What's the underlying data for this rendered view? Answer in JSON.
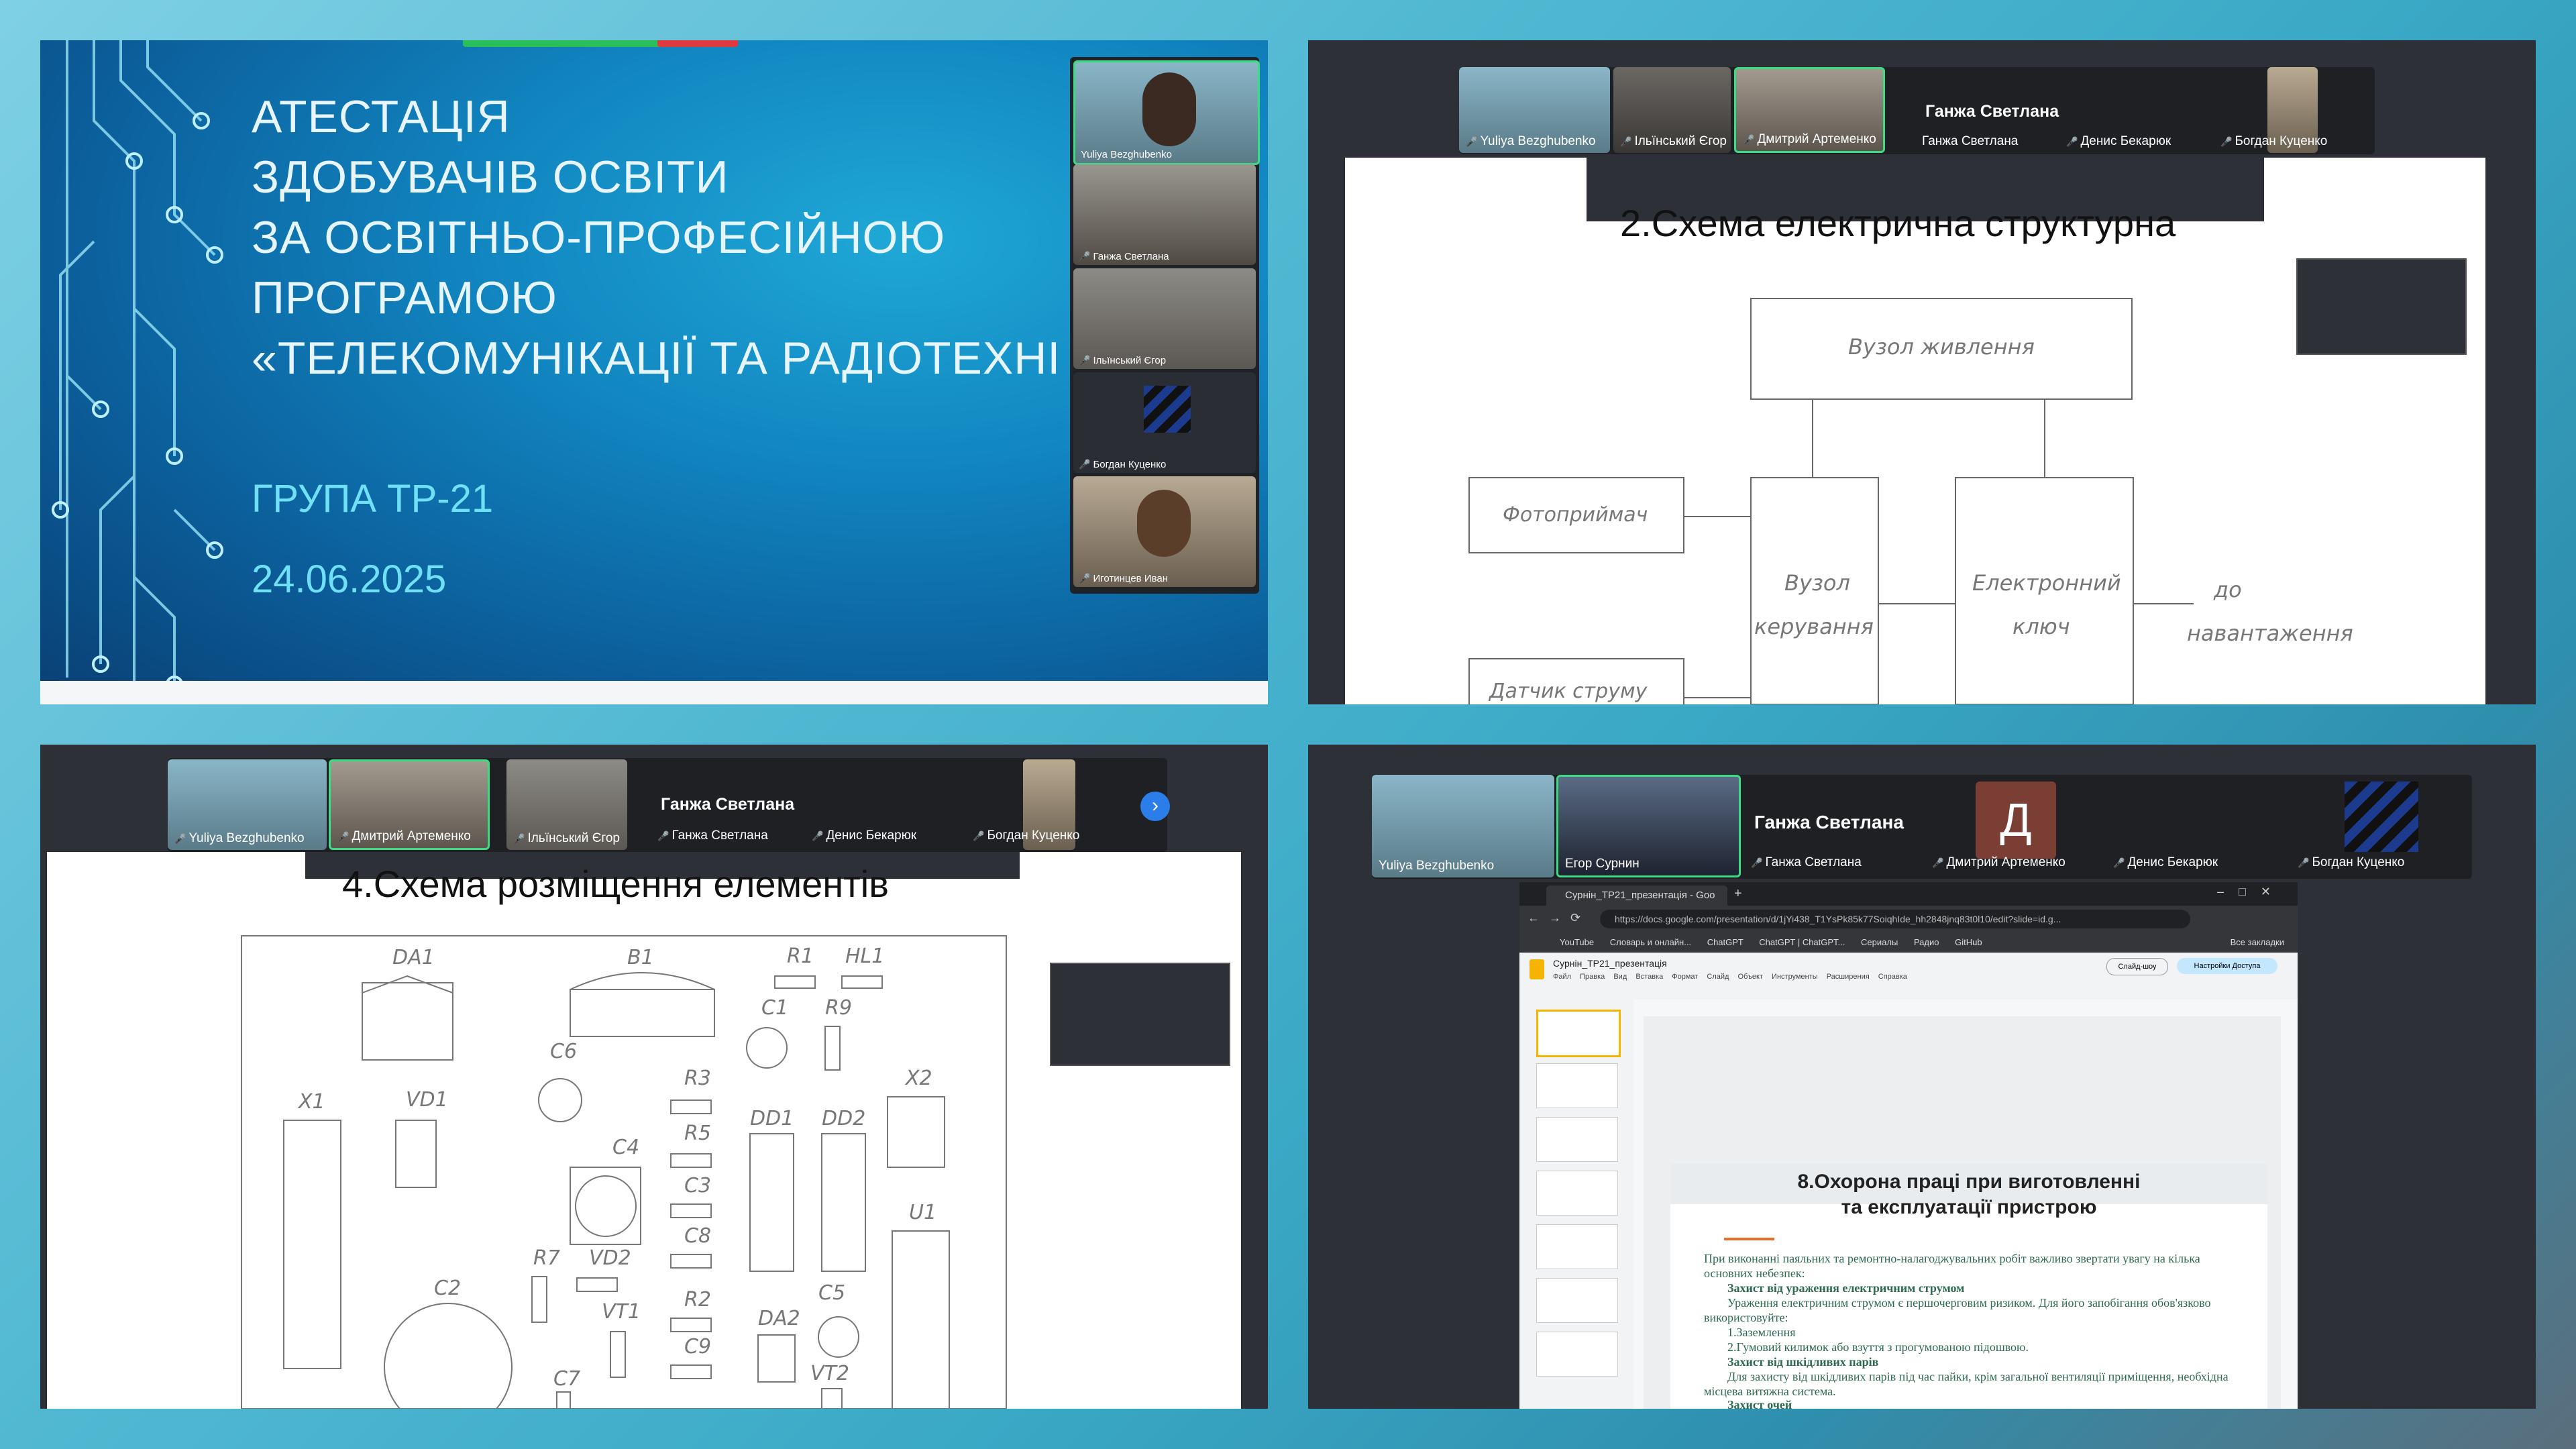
{
  "panel1": {
    "title_lines": [
      "АТЕСТАЦІЯ",
      "ЗДОБУВАЧІВ ОСВІТИ",
      "ЗА ОСВІТНЬО-ПРОФЕСІЙНОЮ",
      "ПРОГРАМОЮ",
      "«ТЕЛЕКОМУНІКАЦІЇ ТА РАДІОТЕХНІ"
    ],
    "group": "ГРУПА ТР-21",
    "date": "24.06.2025",
    "participants": [
      "Yuliya Bezghubenko",
      "Ганжа Светлана",
      "Ільїнський Єгор",
      "Богдан Куценко",
      "Иготинцев Иван"
    ]
  },
  "panel2": {
    "participants": [
      "Yuliya Bezghubenko",
      "Ільїнський Єгор",
      "Дмитрий Артеменко",
      "Ганжа Светлана",
      "Денис Бекарюк",
      "Богдан Куценко"
    ],
    "speaker": "Ганжа Светлана",
    "slide_title": "2.Схема електрична структурна",
    "blocks": {
      "power": "Вузол живлення",
      "photo": "Фотоприймач",
      "control_1": "Вузол",
      "control_2": "керування",
      "switch_1": "Електронний",
      "switch_2": "ключ",
      "load_1": "до",
      "load_2": "навантаження",
      "sensor": "Датчик струму"
    }
  },
  "panel3": {
    "participants": [
      "Yuliya Bezghubenko",
      "Дмитрий Артеменко",
      "Ільїнський Єгор",
      "Ганжа Светлана",
      "Денис Бекарюк",
      "Богдан Куценко"
    ],
    "speaker": "Ганжа Светлана",
    "slide_title": "4.Схема розміщення елементів",
    "components": [
      "DA1",
      "B1",
      "R1",
      "HL1",
      "C1",
      "R9",
      "C6",
      "R3",
      "X1",
      "VD1",
      "C4",
      "R5",
      "DD1",
      "DD2",
      "X2",
      "C3",
      "C8",
      "U1",
      "R7",
      "VD2",
      "C2",
      "VT1",
      "R2",
      "C9",
      "DA2",
      "C5",
      "VT2",
      "C7"
    ]
  },
  "panel4": {
    "participants": [
      "Yuliya Bezghubenko",
      "Егор Сурнин",
      "Ганжа Светлана",
      "Дмитрий Артеменко",
      "Денис Бекарюк",
      "Богдан Куценко"
    ],
    "speaker": "Ганжа Светлана",
    "avatar_letter": "Д",
    "browser": {
      "tab": "Сурнін_ТР21_презентація - Goo",
      "url": "https://docs.google.com/presentation/d/1jYi438_T1YsPk85k77SoiqhIde_hh2848jnq83t0l10/edit?slide=id.g...",
      "bookmarks": [
        "YouTube",
        "Словарь и онлайн...",
        "ChatGPT",
        "ChatGPT | ChatGPT...",
        "Сериалы",
        "Радио",
        "GitHub",
        "Все закладки"
      ],
      "doc_title": "Сурнін_ТР21_презентація",
      "menu": [
        "Файл",
        "Правка",
        "Вид",
        "Вставка",
        "Формат",
        "Слайд",
        "Объект",
        "Инструменты",
        "Расширения",
        "Справка"
      ],
      "slideshow": "Слайд-шоу",
      "share": "Настройки Доступа"
    },
    "slide_title_1": "8.Охорона праці при виготовленні",
    "slide_title_2": "та експлуатації пристрою",
    "text_lines": [
      "При виконанні паяльних та ремонтно-налагоджувальних робіт важливо звертати увагу на кілька",
      "основних небезпек:",
      "Захист від ураження електричним струмом",
      "Ураження електричним струмом є першочерговим ризиком. Для його запобігання обов'язково",
      "використовуйте:",
      "1.Заземлення",
      "2.Гумовий килимок або взуття з прогумованою підошвою.",
      "Захист від шкідливих парів",
      "Для захисту від шкідливих парів під час пайки, крім загальної вентиляції приміщення, необхідна",
      "місцева витяжна система.",
      "Захист очей"
    ]
  },
  "colors": {
    "active_border": "#3ddc84",
    "mic_muted": "#ff4040",
    "slide_blue": "#1185c0"
  }
}
